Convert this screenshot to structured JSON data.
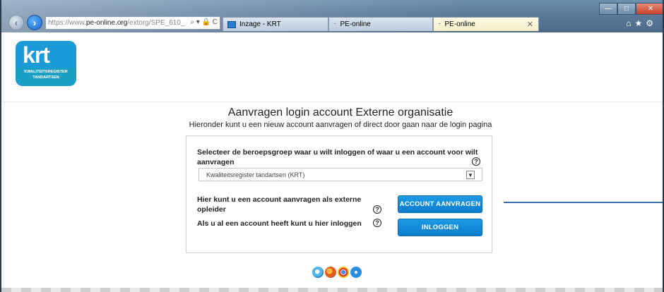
{
  "browser": {
    "url_prefix": "https://www.",
    "url_domain": "pe-online.org",
    "url_rest": "/extorg/SPE_610_",
    "url_tools": "⌕ ▾ 🔒 C",
    "tabs": [
      {
        "label": "Inzage - KRT"
      },
      {
        "label": "PE-online"
      },
      {
        "label": "PE-online",
        "close": "✕"
      }
    ],
    "window_controls": {
      "min": "—",
      "max": "□",
      "close": "✕"
    },
    "toolbar_icons": "⌂★⚙"
  },
  "logo": {
    "word": "krt",
    "subtitle": "KWALITEITSREGISTER\nTANDARTSEN"
  },
  "header": {
    "title": "Aanvragen login account Externe organisatie",
    "subtitle": "Hieronder kunt u een nieuw account aanvragen of direct door gaan naar de login pagina"
  },
  "form": {
    "group_question": "Selecteer de beroepsgroep waar u wilt inloggen of waar u een account voor wilt aanvragen",
    "group_selected": "Kwaliteitsregister tandartsen (KRT)",
    "request_text": "Hier kunt u een account aanvragen als externe opleider",
    "request_button": "ACCOUNT AANVRAGEN",
    "login_text": "Als u al een account heeft kunt u hier inloggen",
    "login_button": "INLOGGEN",
    "help_symbol": "?"
  },
  "colors": {
    "brand": "#1b9cd8",
    "button": "#0b7ccc"
  }
}
